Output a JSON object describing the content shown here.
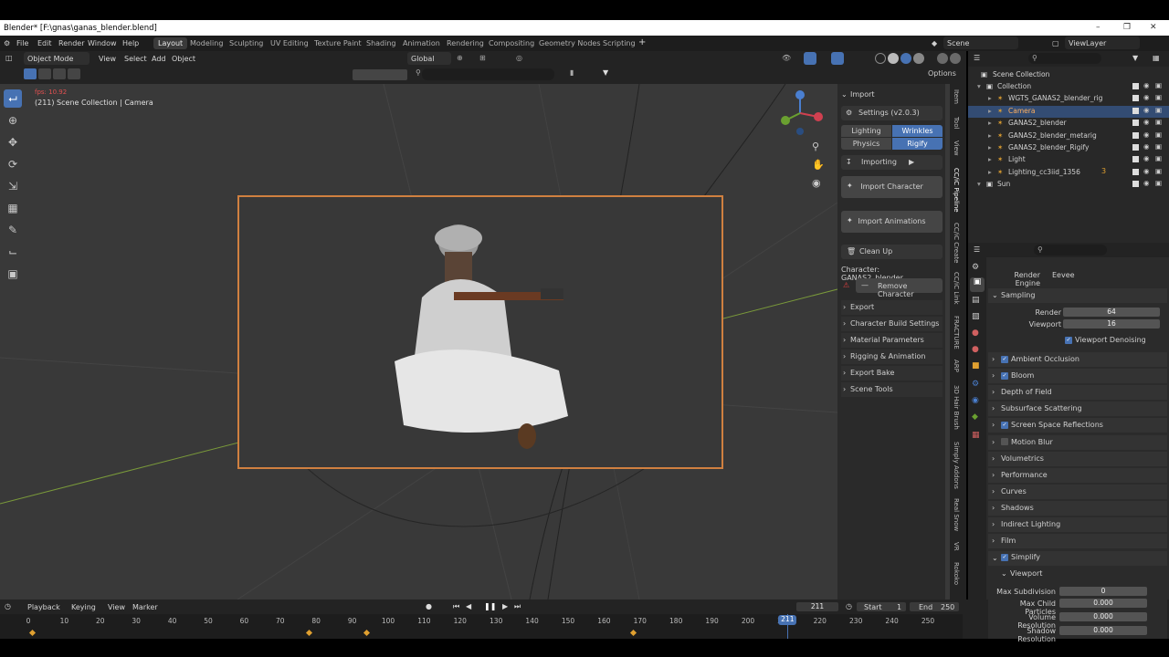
{
  "window": {
    "title": "Blender* [F:\\gnas\\ganas_blender.blend]"
  },
  "menu": [
    "File",
    "Edit",
    "Render",
    "Window",
    "Help"
  ],
  "workspaces": [
    "Layout",
    "Modeling",
    "Sculpting",
    "UV Editing",
    "Texture Paint",
    "Shading",
    "Animation",
    "Rendering",
    "Compositing",
    "Geometry Nodes",
    "Scripting"
  ],
  "active_workspace": "Layout",
  "scene": {
    "label": "Scene",
    "view_layer": "ViewLayer"
  },
  "viewport_header": {
    "mode": "Object Mode",
    "menus": [
      "View",
      "Select",
      "Add",
      "Object"
    ],
    "orientation": "Global",
    "options": "Options"
  },
  "viewport": {
    "fps": "fps: 10.92",
    "info": "(211) Scene Collection | Camera"
  },
  "npanel": {
    "import_header": "Import",
    "settings": "Settings  (v2.0.3)",
    "toggles": [
      "Lighting",
      "Wrinkles",
      "Physics",
      "Rigify"
    ],
    "importing": "Importing",
    "import_character": "Import Character",
    "import_animations": "Import Animations",
    "clean_up": "Clean Up",
    "character": "Character: GANAS2_blender",
    "remove_character": "Remove Character",
    "sections": [
      "Export",
      "Character Build Settings",
      "Material Parameters",
      "Rigging & Animation",
      "Export Bake",
      "Scene Tools"
    ]
  },
  "side_tabs": [
    "Item",
    "Tool",
    "View",
    "CC/iC Pipeline",
    "CC/iC Create",
    "CC/iC Link",
    "FRACTURE",
    "ARP",
    "3D Hair Brush",
    "Simply Addons",
    "Real Snow",
    "VR",
    "Rokoko"
  ],
  "outliner": {
    "root": "Scene Collection",
    "items": [
      {
        "name": "Collection",
        "indent": 1
      },
      {
        "name": "WGTS_GANAS2_blender_rig",
        "indent": 2
      },
      {
        "name": "Camera",
        "indent": 2,
        "selected": true
      },
      {
        "name": "GANAS2_blender",
        "indent": 2
      },
      {
        "name": "GANAS2_blender_metarig",
        "indent": 2
      },
      {
        "name": "GANAS2_blender_Rigify",
        "indent": 2
      },
      {
        "name": "Light",
        "indent": 2
      },
      {
        "name": "Lighting_cc3iid_1356",
        "indent": 2
      },
      {
        "name": "Sun",
        "indent": 1
      }
    ],
    "lighting_count": "3"
  },
  "properties": {
    "render_engine_label": "Render Engine",
    "render_engine": "Eevee",
    "sampling": "Sampling",
    "render_label": "Render",
    "render_value": "64",
    "viewport_label": "Viewport",
    "viewport_value": "16",
    "viewport_denoising": "Viewport Denoising",
    "panels": [
      {
        "label": "Ambient Occlusion",
        "check": true
      },
      {
        "label": "Bloom",
        "check": true
      },
      {
        "label": "Depth of Field",
        "check": null
      },
      {
        "label": "Subsurface Scattering",
        "check": null
      },
      {
        "label": "Screen Space Reflections",
        "check": true
      },
      {
        "label": "Motion Blur",
        "check": false
      },
      {
        "label": "Volumetrics",
        "check": null
      },
      {
        "label": "Performance",
        "check": null
      },
      {
        "label": "Curves",
        "check": null
      },
      {
        "label": "Shadows",
        "check": null
      },
      {
        "label": "Indirect Lighting",
        "check": null
      },
      {
        "label": "Film",
        "check": null
      }
    ],
    "simplify": "Simplify",
    "simplify_viewport": "Viewport",
    "simplify_fields": [
      {
        "label": "Max Subdivision",
        "value": "0"
      },
      {
        "label": "Max Child Particles",
        "value": "0.000"
      },
      {
        "label": "Volume Resolution",
        "value": "0.000"
      },
      {
        "label": "Shadow Resolution",
        "value": "0.000"
      }
    ]
  },
  "timeline": {
    "menus": [
      "Playback",
      "Keying",
      "View",
      "Marker"
    ],
    "current_frame": "211",
    "start_label": "Start",
    "start": "1",
    "end_label": "End",
    "end": "250",
    "ticks": [
      "0",
      "10",
      "20",
      "30",
      "40",
      "50",
      "60",
      "70",
      "80",
      "90",
      "100",
      "110",
      "120",
      "130",
      "140",
      "150",
      "160",
      "170",
      "180",
      "190",
      "200",
      "210",
      "220",
      "230",
      "240",
      "250"
    ],
    "playhead": "211",
    "keyframes": [
      1,
      78,
      94,
      168
    ]
  }
}
